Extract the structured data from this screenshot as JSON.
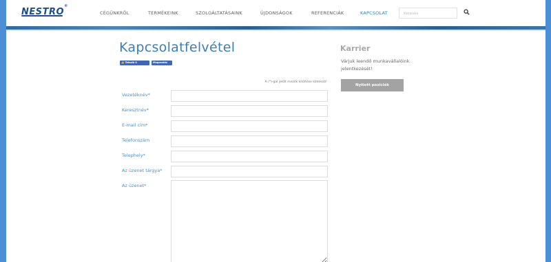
{
  "header": {
    "logo_text": "NESTRO",
    "logo_mark": "®",
    "nav": [
      {
        "label": "CÉGÜNKRŐL",
        "active": false
      },
      {
        "label": "TERMÉKEINK",
        "active": false
      },
      {
        "label": "SZOLGÁLTATÁSAINK",
        "active": false
      },
      {
        "label": "ÚJDONSÁGOK",
        "active": false
      },
      {
        "label": "REFERENCIÁK",
        "active": false
      },
      {
        "label": "KAPCSOLAT",
        "active": true
      }
    ],
    "search_placeholder": "Keresés",
    "search_icon": "search-icon"
  },
  "main": {
    "title": "Kapcsolatfelvétel",
    "fb_like_label": "👍 Tetszik 0",
    "fb_share_label": "Megosztás",
    "required_note": "A (*)-gal jelölt mezők kitöltése kötelező!",
    "fields": [
      {
        "label": "Vezetéknév*",
        "value": ""
      },
      {
        "label": "Keresztnév*",
        "value": ""
      },
      {
        "label": "E-mail cím*",
        "value": ""
      },
      {
        "label": "Telefonszám",
        "value": ""
      },
      {
        "label": "Telephely*",
        "value": ""
      },
      {
        "label": "Az üzenet tárgya*",
        "value": ""
      },
      {
        "label": "Az üzenet*",
        "value": ""
      }
    ]
  },
  "sidebar": {
    "title": "Karrier",
    "text": "Várjuk leendő munkavállalóink jelentkezését!",
    "button_label": "Nyitott pozíciók"
  },
  "colors": {
    "frame": "#4b90d6",
    "accent": "#3a7fb5",
    "button": "#a3a3a3"
  }
}
